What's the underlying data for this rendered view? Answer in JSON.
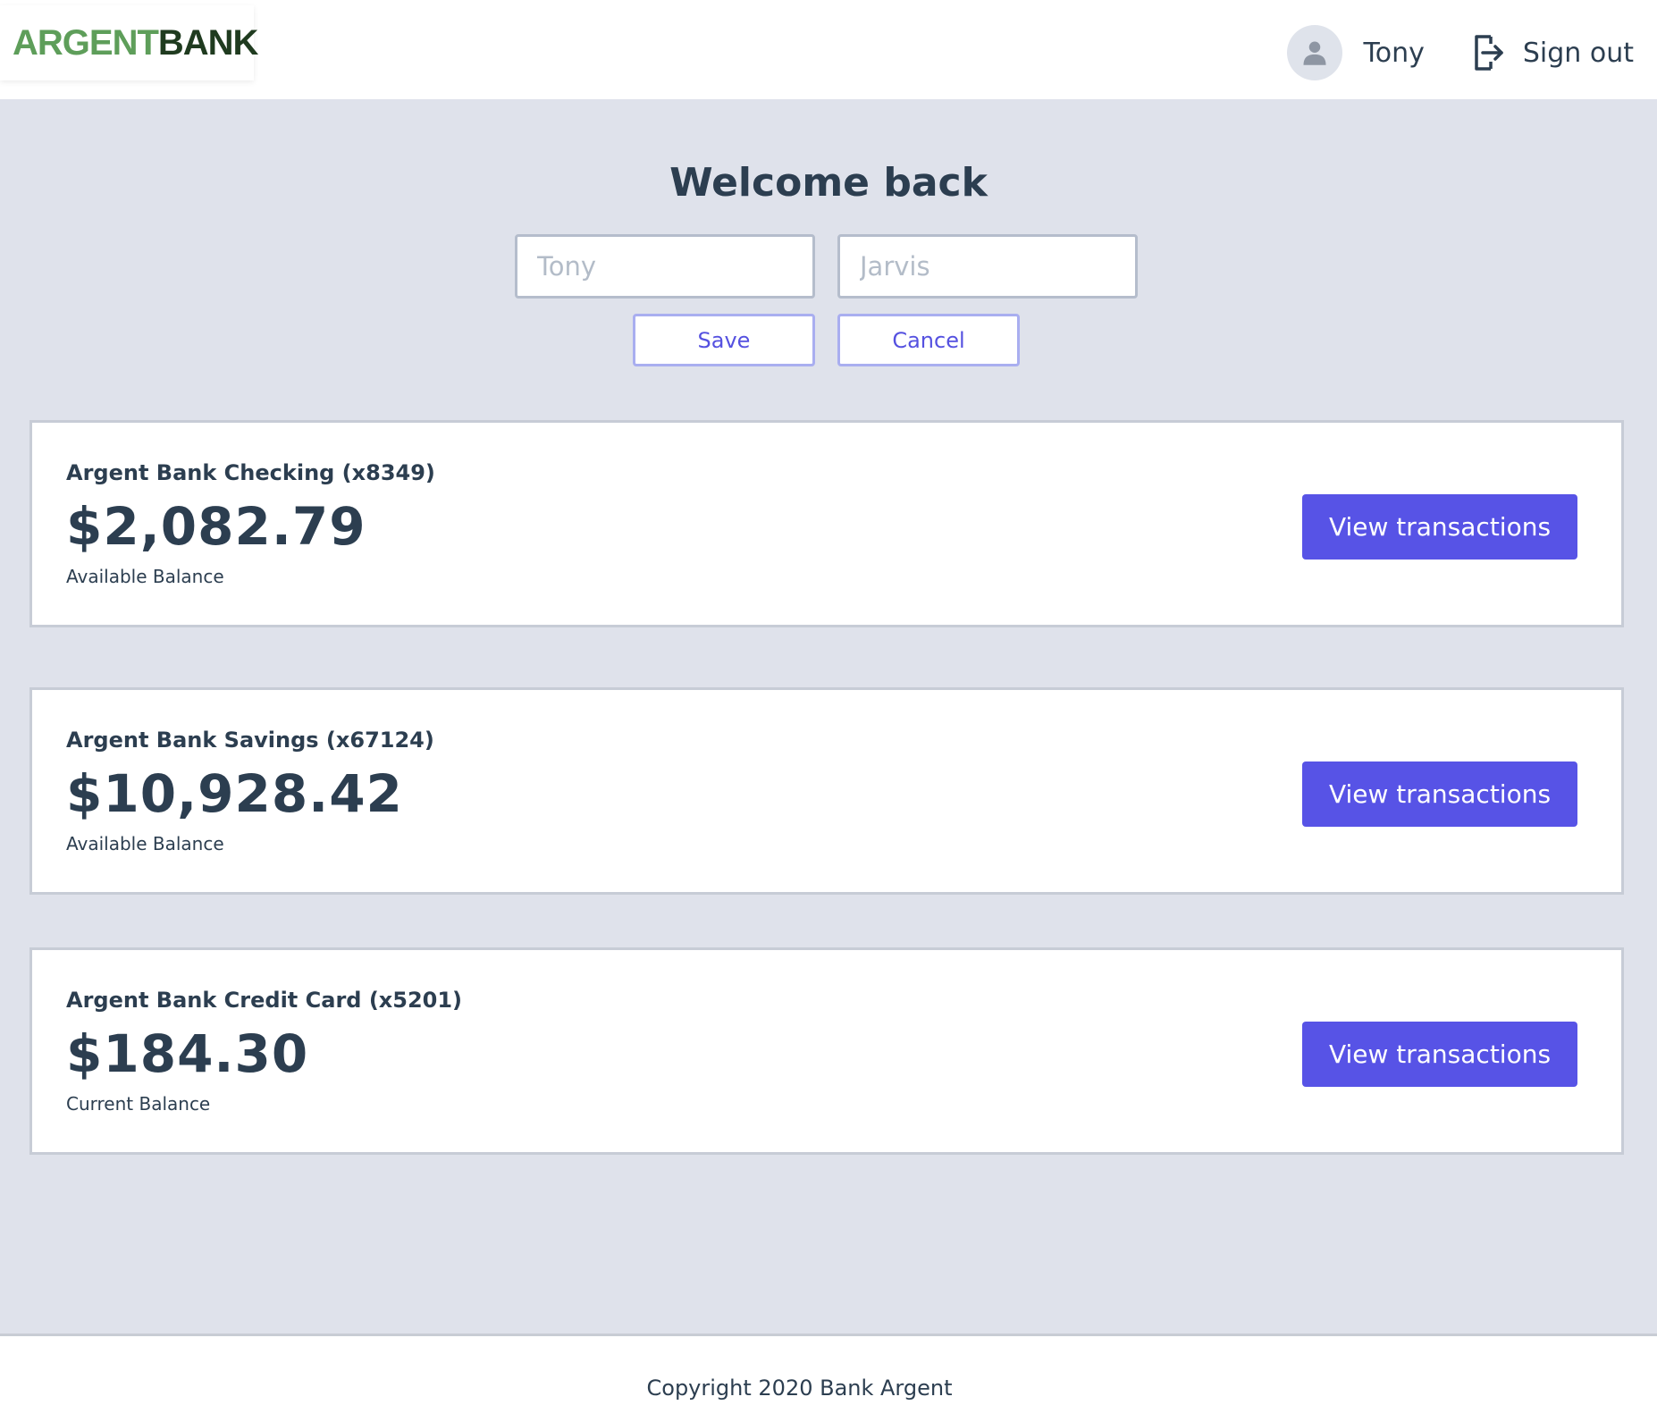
{
  "header": {
    "logo": {
      "part1": "ARGENT",
      "part2": "BANK"
    },
    "user_name": "Tony",
    "signout_label": "Sign out"
  },
  "profile": {
    "title": "Welcome back",
    "first_name_placeholder": "Tony",
    "last_name_placeholder": "Jarvis",
    "save_label": "Save",
    "cancel_label": "Cancel"
  },
  "accounts": [
    {
      "title": "Argent Bank Checking (x8349)",
      "amount": "$2,082.79",
      "description": "Available Balance",
      "button_label": "View transactions"
    },
    {
      "title": "Argent Bank Savings (x67124)",
      "amount": "$10,928.42",
      "description": "Available Balance",
      "button_label": "View transactions"
    },
    {
      "title": "Argent Bank Credit Card (x5201)",
      "amount": "$184.30",
      "description": "Current Balance",
      "button_label": "View transactions"
    }
  ],
  "footer": {
    "copyright": "Copyright 2020 Bank Argent"
  },
  "colors": {
    "primary": "#5753e6",
    "background": "#dfe2eb",
    "logo_green": "#5e9e5a",
    "logo_dark": "#1f3b1f",
    "text": "#2c3e50"
  },
  "icons": {
    "avatar": "user-circle-icon",
    "signout": "sign-out-icon"
  }
}
